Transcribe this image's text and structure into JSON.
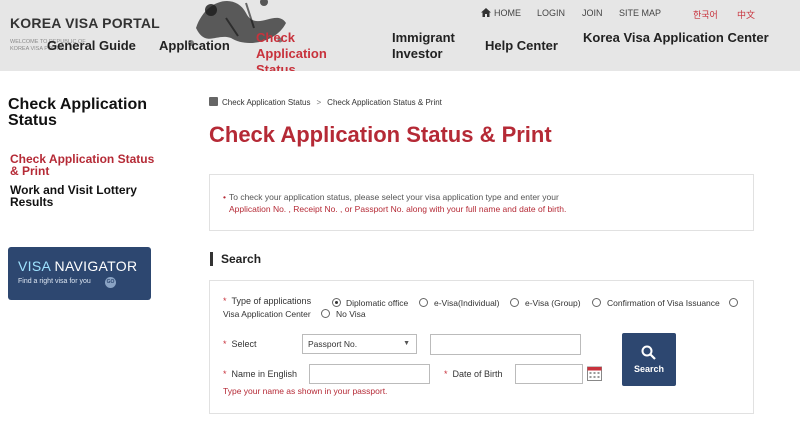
{
  "header": {
    "logo_title": "KOREA VISA PORTAL",
    "logo_subtitle": "WELCOME TO REPUBLIC OF KOREA VISA PORTAL",
    "utility": {
      "home": "HOME",
      "login": "LOGIN",
      "join": "JOIN",
      "sitemap": "SITE MAP",
      "lang_korean": "한국어",
      "lang_chinese": "中文"
    },
    "nav": [
      {
        "label": "General Guide"
      },
      {
        "label": "Application"
      },
      {
        "label": "Check Application Status"
      },
      {
        "label": "Immigrant Investor"
      },
      {
        "label": "Help Center"
      },
      {
        "label": "Korea Visa Application Center"
      }
    ]
  },
  "sidebar": {
    "title": "Check Application Status",
    "links": [
      {
        "label": "Check Application Status & Print",
        "active": true
      },
      {
        "label": "Work and Visit Lottery Results",
        "active": false
      }
    ],
    "banner": {
      "title_a": "VISA",
      "title_b": " NAVIGATOR",
      "subtitle": "Find a right visa for you",
      "go": "GO"
    }
  },
  "breadcrumb": [
    "Check Application Status",
    ">",
    "Check Application Status & Print"
  ],
  "page_title": "Check Application Status & Print",
  "notice": {
    "line1": "To check your application status, please select your visa application type and enter your",
    "line2": "Application No. , Receipt No. , or Passport No. along with your full name and date of birth."
  },
  "search": {
    "section_title": "Search",
    "type_label": "Type of applications",
    "types": [
      "Diplomatic office",
      "e-Visa(Individual)",
      "e-Visa (Group)",
      "Confirmation of Visa Issuance",
      "Visa Application Center",
      "No Visa"
    ],
    "selected_type": "Diplomatic office",
    "select_label": "Select",
    "select_value": "Passport No.",
    "select_value_input": "",
    "name_label": "Name in English",
    "name_value": "",
    "dob_label": "Date of Birth",
    "dob_value": "",
    "button_label": "Search",
    "hint": "Type your name as shown in your passport.",
    "required_mark": "*"
  },
  "colors": {
    "accent": "#b52a36",
    "navy": "#2d4770",
    "header_bg": "#e6e6e6"
  }
}
